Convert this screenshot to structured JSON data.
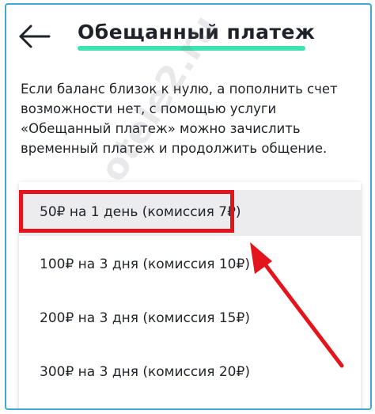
{
  "header": {
    "title": "Обещанный платеж",
    "back_icon": "arrow-left-icon",
    "accent_color": "#3fe3b1"
  },
  "description": "Если баланс близок к нулю, а пополнить счет возможности нет, с помощью услуги «Обещанный платеж» можно зачислить временный платеж и продолжить общение.",
  "options": [
    {
      "label": "50₽ на 1 день (комиссия 7₽)",
      "selected": true
    },
    {
      "label": "100₽ на 3 дня (комиссия 10₽)",
      "selected": false
    },
    {
      "label": "200₽ на 3 дня (комиссия 15₽)",
      "selected": false
    },
    {
      "label": "300₽ на 3 дня (комиссия 20₽)",
      "selected": false
    }
  ],
  "annotation": {
    "highlight_color": "#e3141c",
    "watermark": "otele2.ru"
  }
}
